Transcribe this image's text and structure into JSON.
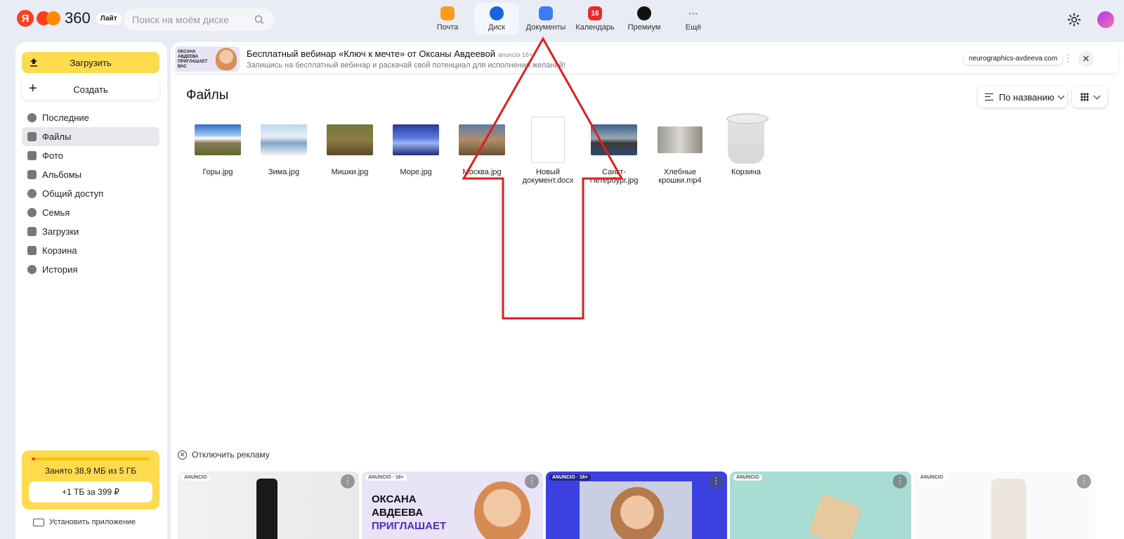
{
  "header": {
    "logo_ya": "Я",
    "logo_num": "360",
    "logo_badge": "Лайт",
    "search_placeholder": "Поиск на моём диске",
    "services": [
      {
        "label": "Почта",
        "color": "#ff9a1f"
      },
      {
        "label": "Диск",
        "color": "#1565e0"
      },
      {
        "label": "Документы",
        "color": "#3b7cf0"
      },
      {
        "label": "Календарь",
        "color": "#e82a2a",
        "badge": "16"
      },
      {
        "label": "Премиум",
        "color": "#111111"
      },
      {
        "label": "Ещё",
        "color": "#ffffff"
      }
    ]
  },
  "sidebar": {
    "upload_label": "Загрузить",
    "create_label": "Создать",
    "items": [
      {
        "label": "Последние"
      },
      {
        "label": "Файлы"
      },
      {
        "label": "Фото"
      },
      {
        "label": "Альбомы"
      },
      {
        "label": "Общий доступ"
      },
      {
        "label": "Семья"
      },
      {
        "label": "Загрузки"
      },
      {
        "label": "Корзина"
      },
      {
        "label": "История"
      }
    ],
    "storage_text": "Занято 38,9 МБ из 5 ГБ",
    "storage_button": "+1 ТБ за 399 ₽",
    "install_label": "Установить приложение"
  },
  "ad": {
    "thumb_text": "ОКСАНА АВДЕЕВА ПРИГЛАШАЕТ ВАС",
    "title": "Бесплатный вебинар «Ключ к мечте» от Оксаны Авдеевой",
    "tag": "anuncio 16+",
    "subtitle": "Запишись на бесплатный вебинар и раскачай свой потенциал для исполнения желаний!",
    "link": "neurographics-avdeeva.com"
  },
  "main": {
    "title": "Файлы",
    "sort_label": "По названию",
    "files": [
      {
        "name": "Горы.jpg"
      },
      {
        "name": "Зима.jpg"
      },
      {
        "name": "Мишки.jpg"
      },
      {
        "name": "Море.jpg"
      },
      {
        "name": "Москва.jpg"
      },
      {
        "name": "Новый документ.docx"
      },
      {
        "name": "Санкт-Петербург.jpg"
      },
      {
        "name": "Хлебные крошки.mp4"
      },
      {
        "name": "Корзина"
      }
    ],
    "disable_ads": "Отключить рекламу",
    "ad_cards": [
      {
        "label": "ANUNCIO"
      },
      {
        "label": "ANUNCIO · 16+",
        "line1": "ОКСАНА",
        "line2": "АВДЕЕВА",
        "line3": "ПРИГЛАШАЕТ"
      },
      {
        "label": "ANUNCIO · 16+"
      },
      {
        "label": "ANUNCIO"
      },
      {
        "label": "ANUNCIO"
      }
    ]
  }
}
